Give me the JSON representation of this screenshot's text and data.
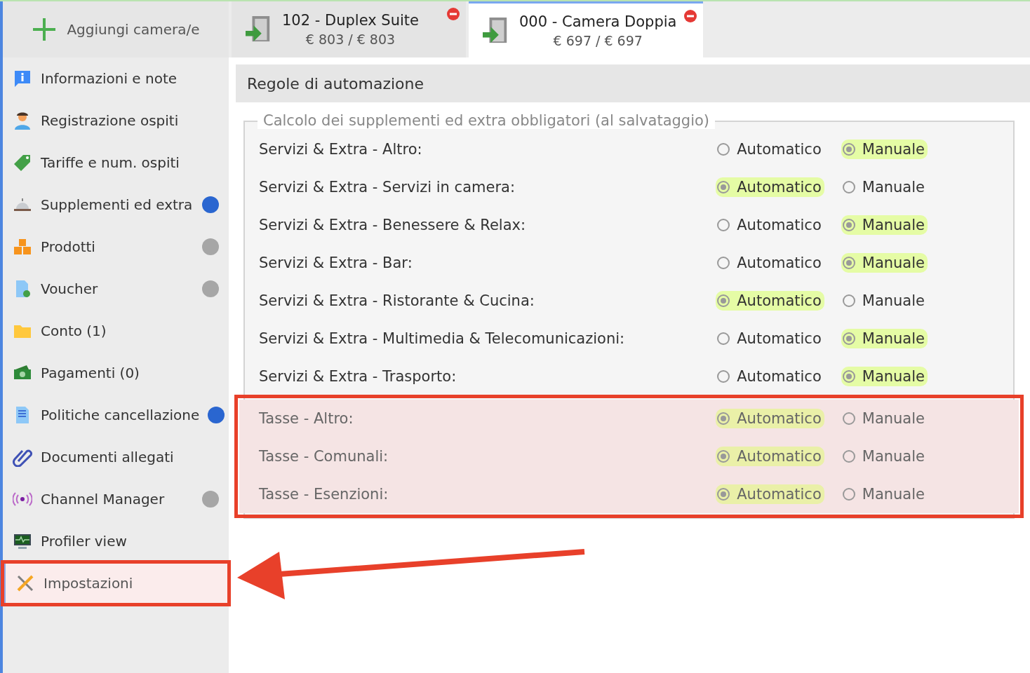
{
  "add_button": {
    "label": "Aggiungi camera/e"
  },
  "room_tabs": [
    {
      "title": "102 - Duplex Suite",
      "price": "€ 803 / € 803",
      "selected": false
    },
    {
      "title": "000 - Camera Doppia",
      "price": "€ 697 / € 697",
      "selected": true
    }
  ],
  "sidebar": {
    "items": [
      {
        "kind": "info",
        "label": "Informazioni e note",
        "selected": false,
        "highlighted": false
      },
      {
        "kind": "guest",
        "label": "Registrazione ospiti",
        "selected": false,
        "highlighted": false
      },
      {
        "kind": "tag",
        "label": "Tariffe e num. ospiti",
        "selected": false,
        "highlighted": false
      },
      {
        "kind": "bell",
        "label": "Supplementi ed extra",
        "selected": false,
        "highlighted": false,
        "color": "#2a66d0"
      },
      {
        "kind": "boxes",
        "label": "Prodotti",
        "selected": false,
        "highlighted": false,
        "color": "#a6a6a6"
      },
      {
        "kind": "voucher",
        "label": "Voucher",
        "selected": false,
        "highlighted": false,
        "color": "#a6a6a6"
      },
      {
        "kind": "folder",
        "label": "Conto (1)",
        "selected": false,
        "highlighted": false
      },
      {
        "kind": "money",
        "label": "Pagamenti (0)",
        "selected": false,
        "highlighted": false
      },
      {
        "kind": "doc",
        "label": "Politiche cancellazione",
        "selected": false,
        "highlighted": false,
        "color": "#2a66d0"
      },
      {
        "kind": "clip",
        "label": "Documenti allegati",
        "selected": false,
        "highlighted": false
      },
      {
        "kind": "signal",
        "label": "Channel Manager",
        "selected": false,
        "highlighted": false,
        "color": "#a6a6a6"
      },
      {
        "kind": "monitor",
        "label": "Profiler view",
        "selected": false,
        "highlighted": false
      },
      {
        "kind": "tools",
        "label": "Impostazioni",
        "selected": true,
        "highlighted": true
      }
    ]
  },
  "section": {
    "title": "Regole di automazione",
    "group_legend": "Calcolo dei supplementi ed extra obbligatori (al salvataggio)",
    "rule_groups": [
      {
        "highlighted": false,
        "rules": [
          {
            "label": "Servizi & Extra - Altro:",
            "options": [
              {
                "label": "Automatico",
                "selected": false
              },
              {
                "label": "Manuale",
                "selected": true
              }
            ]
          },
          {
            "label": "Servizi & Extra - Servizi in camera:",
            "options": [
              {
                "label": "Automatico",
                "selected": true
              },
              {
                "label": "Manuale",
                "selected": false
              }
            ]
          },
          {
            "label": "Servizi & Extra - Benessere & Relax:",
            "options": [
              {
                "label": "Automatico",
                "selected": false
              },
              {
                "label": "Manuale",
                "selected": true
              }
            ]
          },
          {
            "label": "Servizi & Extra - Bar:",
            "options": [
              {
                "label": "Automatico",
                "selected": false
              },
              {
                "label": "Manuale",
                "selected": true
              }
            ]
          },
          {
            "label": "Servizi & Extra - Ristorante & Cucina:",
            "options": [
              {
                "label": "Automatico",
                "selected": true
              },
              {
                "label": "Manuale",
                "selected": false
              }
            ]
          },
          {
            "label": "Servizi & Extra - Multimedia & Telecomunicazioni:",
            "options": [
              {
                "label": "Automatico",
                "selected": false
              },
              {
                "label": "Manuale",
                "selected": true
              }
            ]
          },
          {
            "label": "Servizi & Extra - Trasporto:",
            "options": [
              {
                "label": "Automatico",
                "selected": false
              },
              {
                "label": "Manuale",
                "selected": true
              }
            ]
          }
        ]
      },
      {
        "highlighted": true,
        "rules": [
          {
            "label": "Tasse - Altro:",
            "options": [
              {
                "label": "Automatico",
                "selected": true
              },
              {
                "label": "Manuale",
                "selected": false
              }
            ]
          },
          {
            "label": "Tasse - Comunali:",
            "options": [
              {
                "label": "Automatico",
                "selected": true
              },
              {
                "label": "Manuale",
                "selected": false
              }
            ]
          },
          {
            "label": "Tasse - Esenzioni:",
            "options": [
              {
                "label": "Automatico",
                "selected": true
              },
              {
                "label": "Manuale",
                "selected": false
              }
            ]
          }
        ]
      }
    ]
  }
}
